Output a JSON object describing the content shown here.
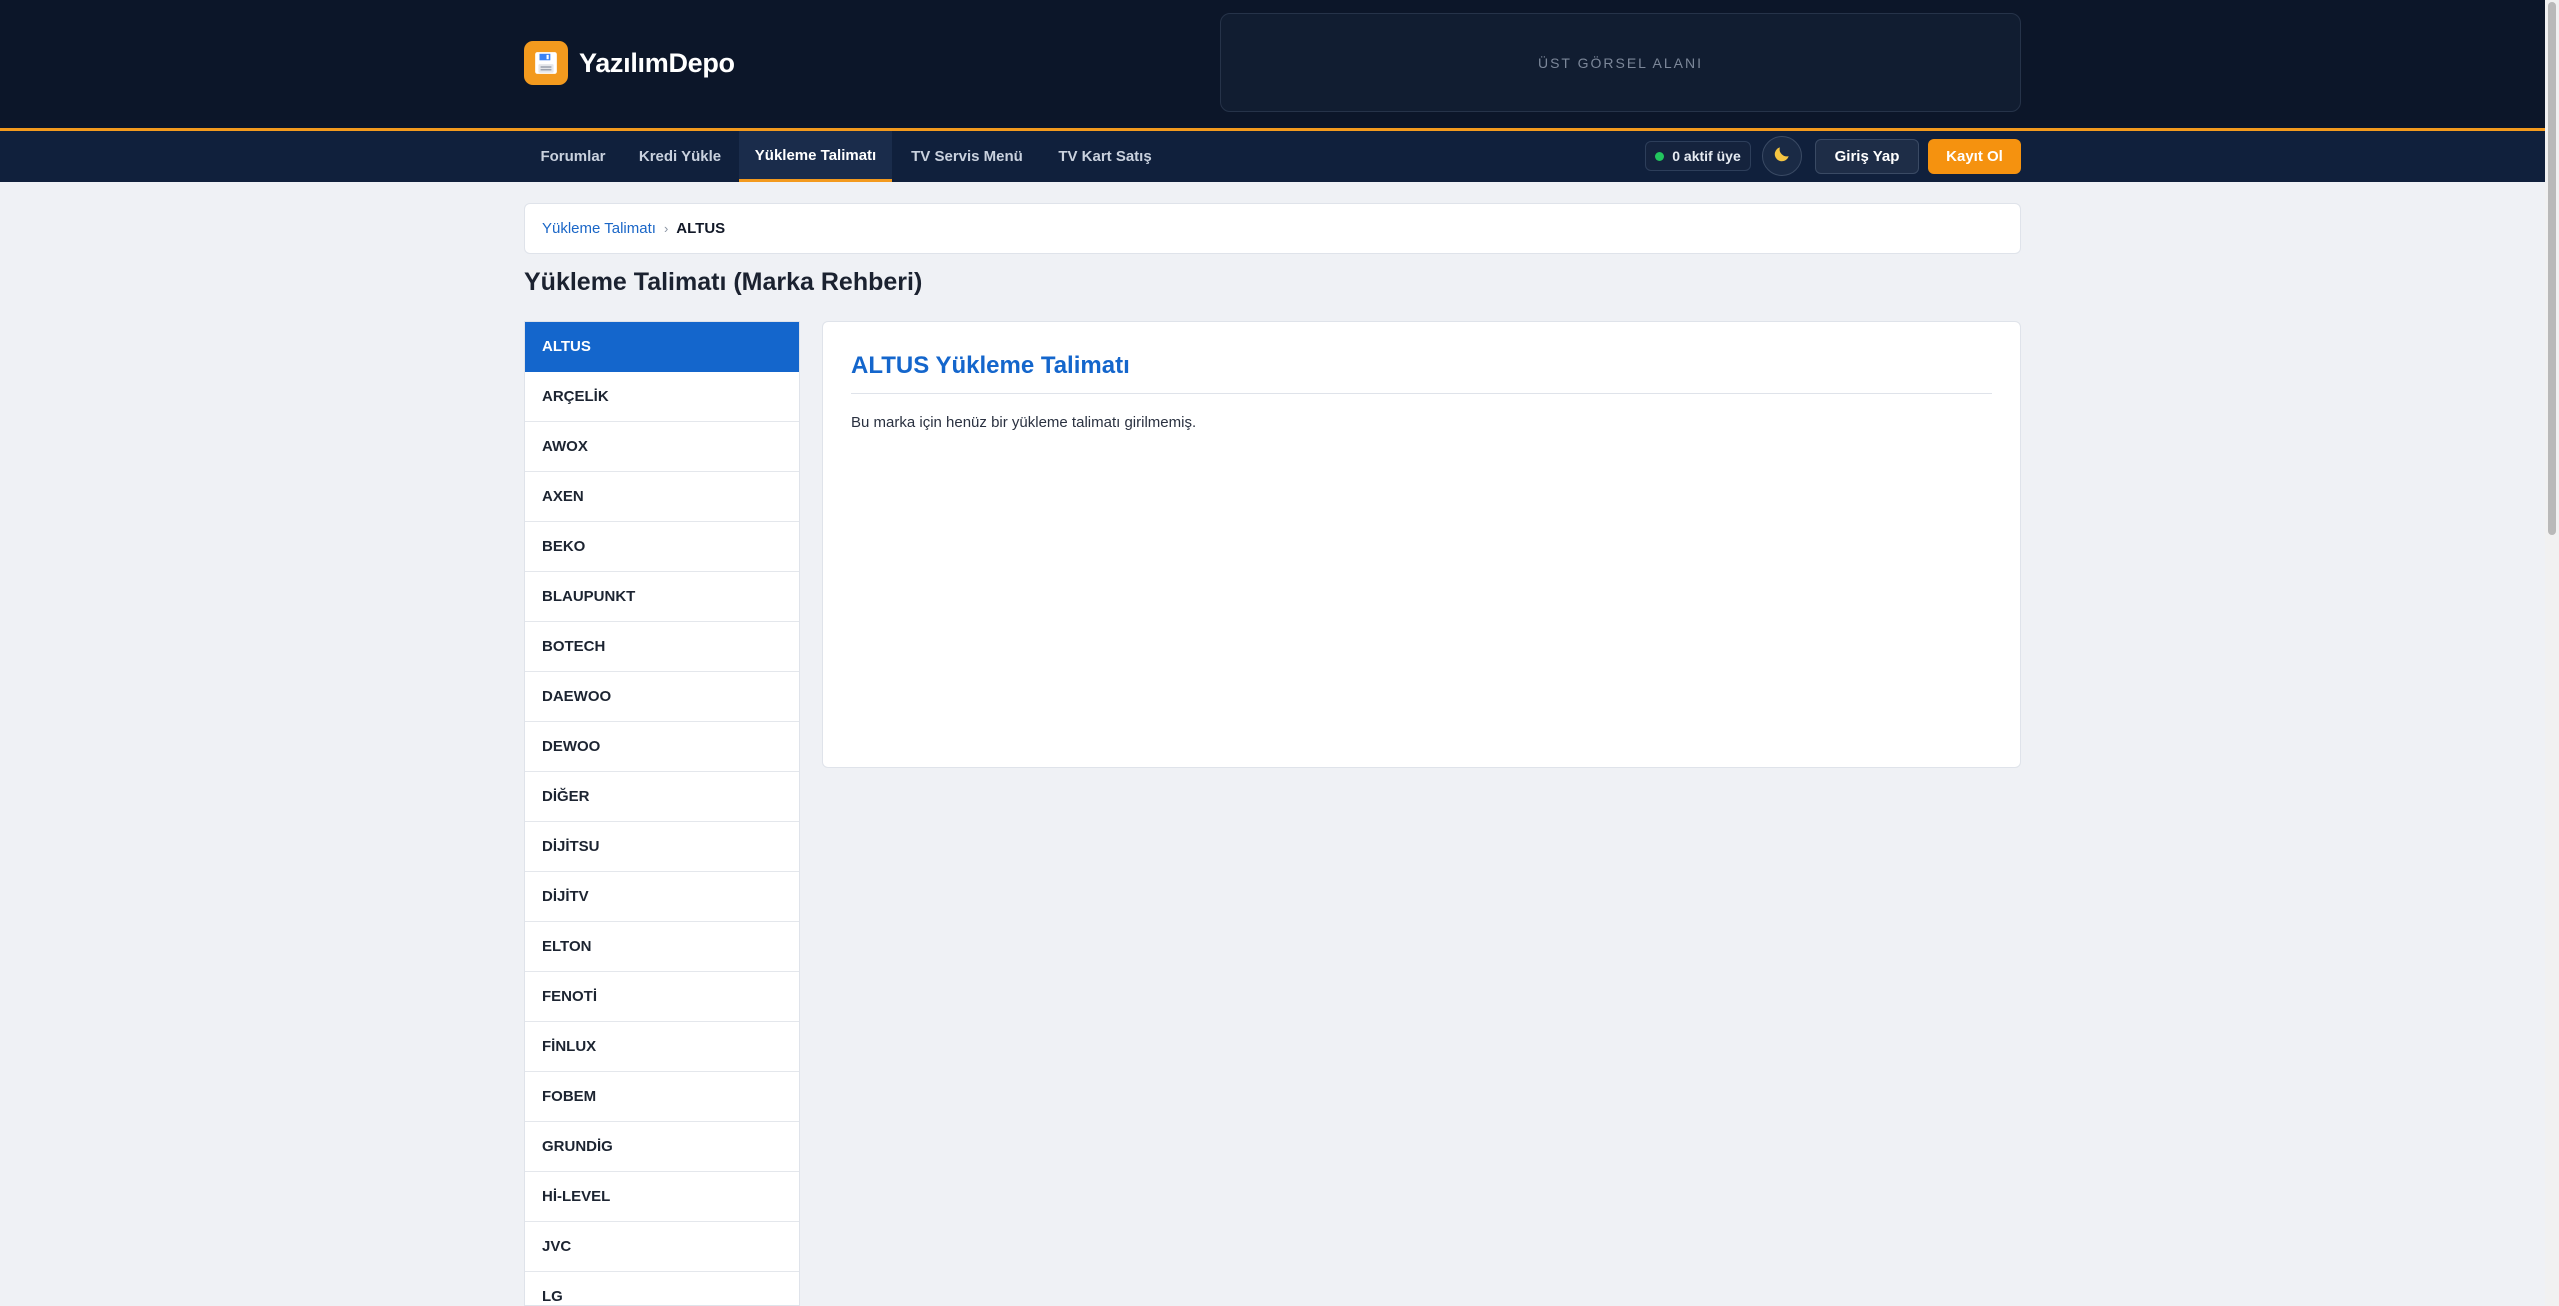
{
  "header": {
    "logo_text": "YazılımDepo",
    "logo_icon": "floppy-disk-icon",
    "ad_slot_text": "ÜST GÖRSEL ALANI"
  },
  "nav": {
    "items": [
      {
        "label": "Forumlar",
        "active": false
      },
      {
        "label": "Kredi Yükle",
        "active": false
      },
      {
        "label": "Yükleme Talimatı",
        "active": true
      },
      {
        "label": "TV Servis Menü",
        "active": false
      },
      {
        "label": "TV Kart Satış",
        "active": false
      }
    ],
    "online_text": "0 aktif üye",
    "theme_toggle_icon": "moon-icon",
    "login_label": "Giriş Yap",
    "register_label": "Kayıt Ol"
  },
  "breadcrumb": {
    "parent": "Yükleme Talimatı",
    "current": "ALTUS"
  },
  "page_title": "Yükleme Talimatı (Marka Rehberi)",
  "brands": {
    "selected": "ALTUS",
    "items": [
      "ALTUS",
      "ARÇELİK",
      "AWOX",
      "AXEN",
      "BEKO",
      "BLAUPUNKT",
      "BOTECH",
      "DAEWOO",
      "DEWOO",
      "DİĞER",
      "DİJİTSU",
      "DİJİTV",
      "ELTON",
      "FENOTİ",
      "FİNLUX",
      "FOBEM",
      "GRUNDİG",
      "Hİ-LEVEL",
      "JVC",
      "LG"
    ]
  },
  "content": {
    "title": "ALTUS Yükleme Talimatı",
    "message": "Bu marka için henüz bir yükleme talimatı girilmemiş."
  },
  "colors": {
    "header_bg": "#0c1629",
    "nav_bg": "#10203c",
    "accent_orange": "#f39a1e",
    "primary_blue": "#1466cc",
    "online_green": "#22c55e"
  }
}
